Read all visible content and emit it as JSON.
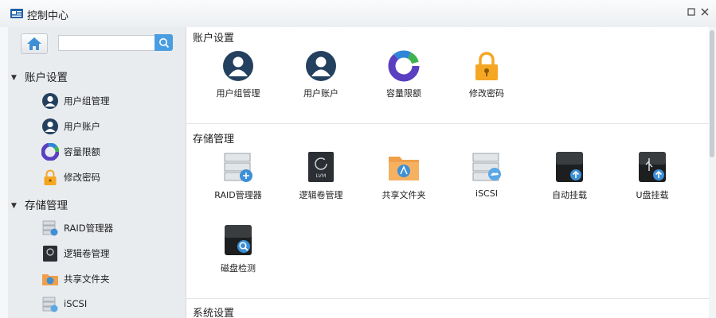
{
  "window": {
    "title": "控制中心"
  },
  "sidebar": {
    "search": {
      "value": "",
      "placeholder": ""
    },
    "groups": [
      {
        "label": "账户设置",
        "items": [
          {
            "label": "用户组管理",
            "icon": "user-group-icon"
          },
          {
            "label": "用户账户",
            "icon": "user-account-icon"
          },
          {
            "label": "容量限额",
            "icon": "quota-pie-icon"
          },
          {
            "label": "修改密码",
            "icon": "lock-icon"
          }
        ]
      },
      {
        "label": "存储管理",
        "items": [
          {
            "label": "RAID管理器",
            "icon": "raid-icon"
          },
          {
            "label": "逻辑卷管理",
            "icon": "lvm-icon"
          },
          {
            "label": "共享文件夹",
            "icon": "shared-folder-icon"
          },
          {
            "label": "iSCSI",
            "icon": "iscsi-icon"
          }
        ]
      }
    ]
  },
  "main": {
    "sections": [
      {
        "title": "账户设置",
        "apps": [
          {
            "label": "用户组管理",
            "icon": "user-group-icon"
          },
          {
            "label": "用户账户",
            "icon": "user-account-icon"
          },
          {
            "label": "容量限额",
            "icon": "quota-pie-icon"
          },
          {
            "label": "修改密码",
            "icon": "lock-icon"
          }
        ]
      },
      {
        "title": "存储管理",
        "apps": [
          {
            "label": "RAID管理器",
            "icon": "raid-icon"
          },
          {
            "label": "逻辑卷管理",
            "icon": "lvm-icon",
            "badge": "LVM"
          },
          {
            "label": "共享文件夹",
            "icon": "shared-folder-icon"
          },
          {
            "label": "iSCSI",
            "icon": "iscsi-icon"
          },
          {
            "label": "自动挂载",
            "icon": "auto-mount-icon"
          },
          {
            "label": "U盘挂载",
            "icon": "usb-mount-icon"
          },
          {
            "label": "磁盘检测",
            "icon": "disk-check-icon"
          }
        ]
      },
      {
        "title": "系统设置",
        "apps": []
      }
    ]
  },
  "colors": {
    "accent": "#4a9de0",
    "user_dark": "#24405f",
    "lock_orange": "#f5a623",
    "sidebar_bg": "#e9ecef"
  }
}
